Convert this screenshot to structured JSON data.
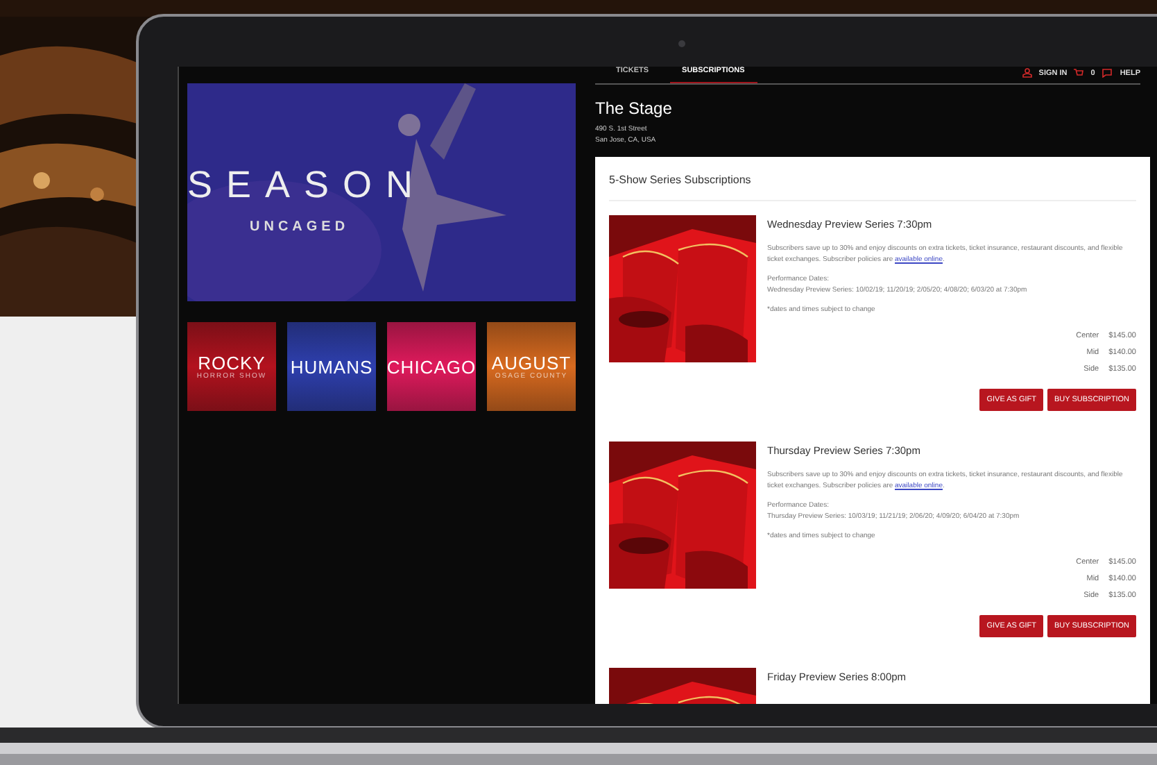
{
  "nav": {
    "tabs": [
      {
        "label": "TICKETS",
        "selected": false
      },
      {
        "label": "SUBSCRIPTIONS",
        "selected": true
      }
    ],
    "sign_in": "SIGN IN",
    "cart_count": "0",
    "help": "HELP"
  },
  "venue": {
    "name": "The Stage",
    "address": [
      "490 S. 1st Street",
      "San Jose, CA, USA"
    ]
  },
  "hero": {
    "title": "SEASON",
    "subtitle": "UNCAGED"
  },
  "shows": [
    {
      "title": "ROCKY",
      "subtitle": "HORROR SHOW",
      "color": "#b3121e"
    },
    {
      "title": "HUMANS",
      "color": "#2e3fae"
    },
    {
      "title": "CHICAGO",
      "color": "#e01a5c"
    },
    {
      "title": "AUGUST",
      "subtitle": "OSAGE COUNTY",
      "color": "#d86a1f"
    }
  ],
  "section_title": "5-Show Series Subscriptions",
  "series": [
    {
      "title": "Wednesday Preview Series 7:30pm",
      "description": "Subscribers save up to 30% and enjoy discounts on extra tickets, ticket insurance, restaurant discounts, and flexible ticket exchanges. Subscriber policies are",
      "link": "available online",
      "description_end": ".",
      "dates_label": "Performance Dates:",
      "dates": "Wednesday Preview Series: 10/02/19; 11/20/19; 2/05/20; 4/08/20; 6/03/20 at 7:30pm",
      "note": "*dates and times subject to change",
      "prices": [
        {
          "tier": "Center",
          "price": "$145.00"
        },
        {
          "tier": "Mid",
          "price": "$140.00"
        },
        {
          "tier": "Side",
          "price": "$135.00"
        }
      ],
      "buttons": [
        "GIVE AS GIFT",
        "BUY SUBSCRIPTION"
      ]
    },
    {
      "title": "Thursday Preview Series 7:30pm",
      "description": "Subscribers save up to 30% and enjoy discounts on extra tickets, ticket insurance, restaurant discounts, and flexible ticket exchanges. Subscriber policies are",
      "link": "available online",
      "description_end": ".",
      "dates_label": "Performance Dates:",
      "dates": "Thursday Preview Series: 10/03/19; 11/21/19; 2/06/20; 4/09/20; 6/04/20 at 7:30pm",
      "note": "*dates and times subject to change",
      "prices": [
        {
          "tier": "Center",
          "price": "$145.00"
        },
        {
          "tier": "Mid",
          "price": "$140.00"
        },
        {
          "tier": "Side",
          "price": "$135.00"
        }
      ],
      "buttons": [
        "GIVE AS GIFT",
        "BUY SUBSCRIPTION"
      ]
    },
    {
      "title": "Friday Preview Series 8:00pm"
    }
  ]
}
